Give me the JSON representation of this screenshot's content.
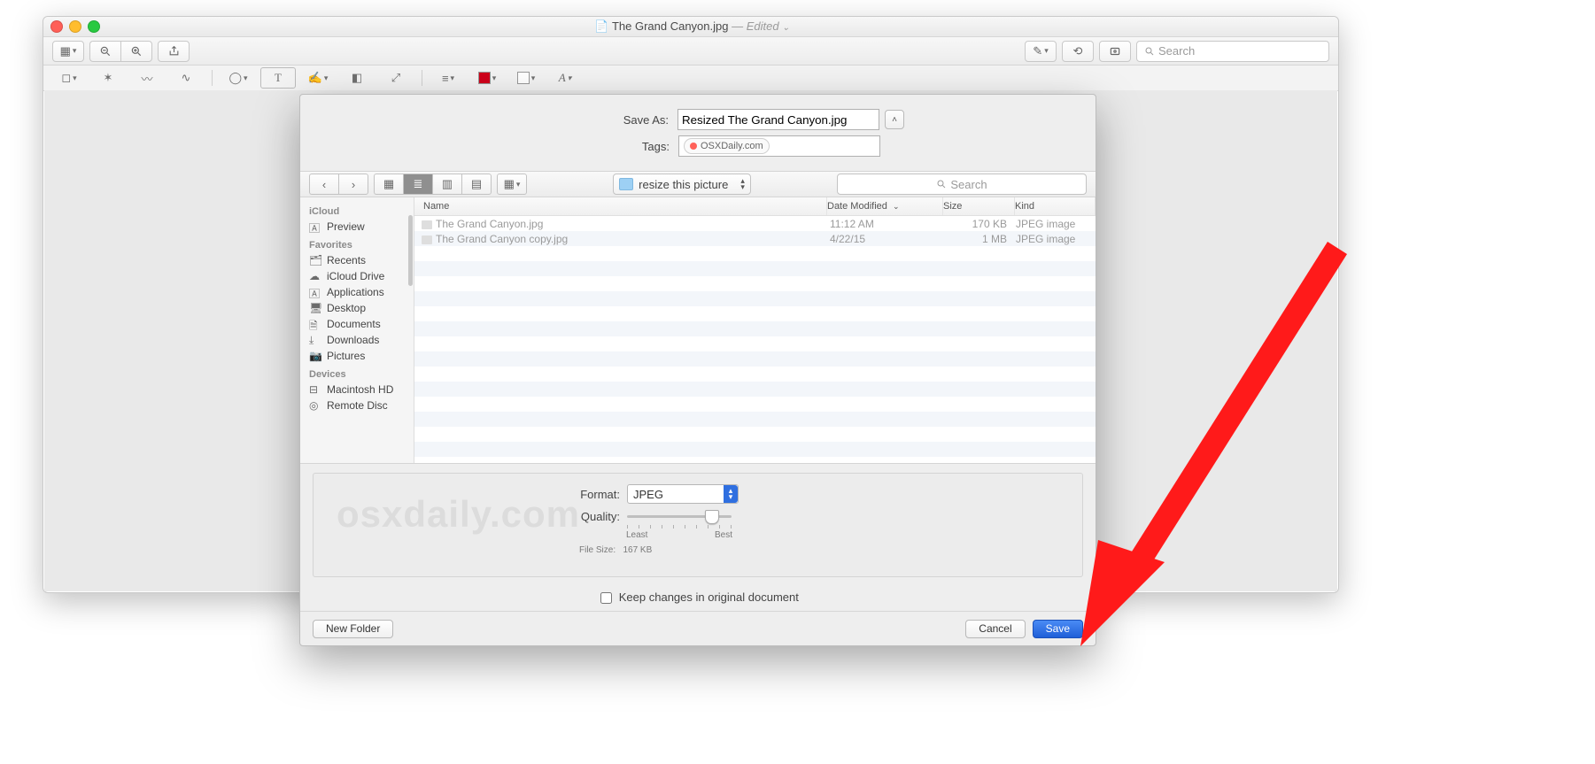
{
  "titlebar": {
    "filename": "The Grand Canyon.jpg",
    "edited_label": "Edited"
  },
  "toolbar": {
    "search_placeholder": "Search"
  },
  "sheet": {
    "save_as_label": "Save As:",
    "save_as_value": "Resized The Grand Canyon.jpg",
    "tags_label": "Tags:",
    "tag_value": "OSXDaily.com",
    "folder_name": "resize this picture",
    "search_placeholder": "Search",
    "columns": {
      "name": "Name",
      "date": "Date Modified",
      "size": "Size",
      "kind": "Kind"
    },
    "files": [
      {
        "name": "The Grand Canyon.jpg",
        "date": "11:12 AM",
        "size": "170 KB",
        "kind": "JPEG image"
      },
      {
        "name": "The Grand Canyon copy.jpg",
        "date": "4/22/15",
        "size": "1 MB",
        "kind": "JPEG image"
      }
    ],
    "sidebar": {
      "group_icloud": "iCloud",
      "group_fav": "Favorites",
      "group_dev": "Devices",
      "items": {
        "preview": "Preview",
        "recents": "Recents",
        "icloud_drive": "iCloud Drive",
        "applications": "Applications",
        "desktop": "Desktop",
        "documents": "Documents",
        "downloads": "Downloads",
        "pictures": "Pictures",
        "mac_hd": "Macintosh HD",
        "remote_disc": "Remote Disc"
      }
    },
    "format_label": "Format:",
    "format_value": "JPEG",
    "quality_label": "Quality:",
    "quality_least": "Least",
    "quality_best": "Best",
    "filesize_label": "File Size:",
    "filesize_value": "167 KB",
    "watermark": "osxdaily.com",
    "keep_changes_label": "Keep changes in original document",
    "new_folder": "New Folder",
    "cancel": "Cancel",
    "save": "Save"
  }
}
